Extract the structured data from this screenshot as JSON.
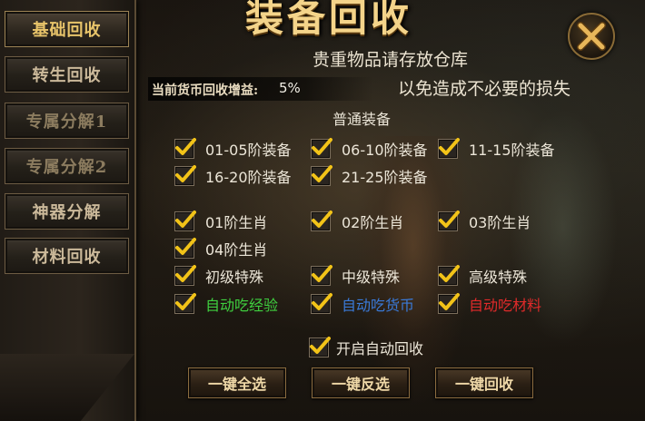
{
  "sidebar": {
    "items": [
      {
        "label": "基础回收"
      },
      {
        "label": "转生回收"
      },
      {
        "label": "专属分解1"
      },
      {
        "label": "专属分解2"
      },
      {
        "label": "神器分解"
      },
      {
        "label": "材料回收"
      }
    ]
  },
  "header": {
    "title": "装备回收",
    "close_icon": "close-x-icon"
  },
  "notice": {
    "line1": "贵重物品请存放仓库",
    "line2": "以免造成不必要的损失"
  },
  "gain": {
    "label": "当前货币回收增益:",
    "value": "5%"
  },
  "section": {
    "heading": "普通装备"
  },
  "options": {
    "eq_01_05": {
      "label": "01-05阶装备",
      "checked": true
    },
    "eq_06_10": {
      "label": "06-10阶装备",
      "checked": true
    },
    "eq_11_15": {
      "label": "11-15阶装备",
      "checked": true
    },
    "eq_16_20": {
      "label": "16-20阶装备",
      "checked": true
    },
    "eq_21_25": {
      "label": "21-25阶装备",
      "checked": true
    },
    "zodiac_01": {
      "label": "01阶生肖",
      "checked": true
    },
    "zodiac_02": {
      "label": "02阶生肖",
      "checked": true
    },
    "zodiac_03": {
      "label": "03阶生肖",
      "checked": true
    },
    "zodiac_04": {
      "label": "04阶生肖",
      "checked": true
    },
    "special_low": {
      "label": "初级特殊",
      "checked": true
    },
    "special_mid": {
      "label": "中级特殊",
      "checked": true
    },
    "special_high": {
      "label": "高级特殊",
      "checked": true
    },
    "auto_exp": {
      "label": "自动吃经验",
      "checked": true,
      "color": "#3fcf3f"
    },
    "auto_currency": {
      "label": "自动吃货币",
      "checked": true,
      "color": "#3a7ad8"
    },
    "auto_material": {
      "label": "自动吃材料",
      "checked": true,
      "color": "#e02a2a"
    },
    "auto_recycle": {
      "label": "开启自动回收",
      "checked": true
    }
  },
  "actions": {
    "select_all": "一键全选",
    "invert": "一键反选",
    "recycle": "一键回收"
  },
  "colors": {
    "accent_gold": "#f4d48a",
    "check_yellow": "#f2c318"
  }
}
